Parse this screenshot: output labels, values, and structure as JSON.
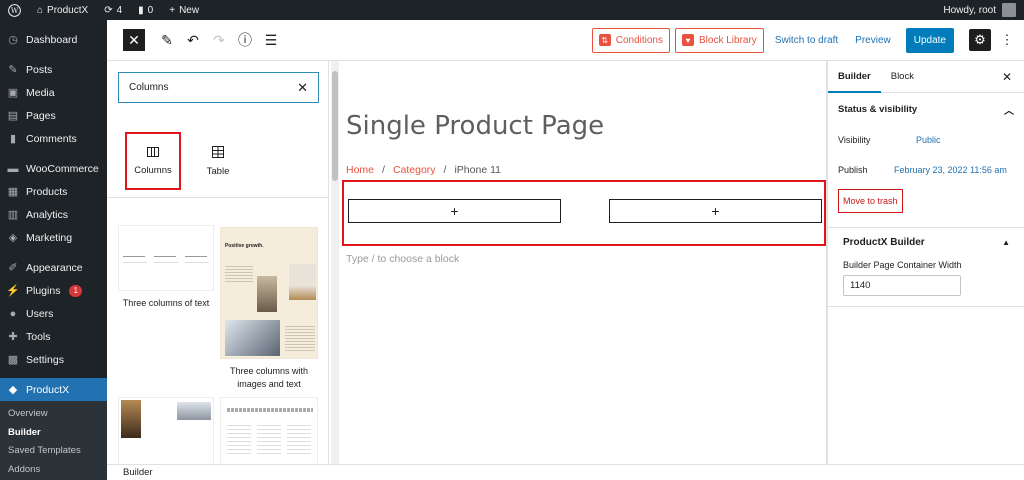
{
  "adminbar": {
    "site_name": "ProductX",
    "updates_count": "4",
    "comments_count": "0",
    "new_label": "New",
    "howdy": "Howdy, root"
  },
  "adminmenu": {
    "items": [
      {
        "label": "Dashboard",
        "icon": "dashboard-icon"
      },
      {
        "label": "Posts",
        "icon": "pin-icon"
      },
      {
        "label": "Media",
        "icon": "media-icon"
      },
      {
        "label": "Pages",
        "icon": "pages-icon"
      },
      {
        "label": "Comments",
        "icon": "comments-icon"
      },
      {
        "label": "WooCommerce",
        "icon": "woo-icon"
      },
      {
        "label": "Products",
        "icon": "archive-icon"
      },
      {
        "label": "Analytics",
        "icon": "bar-chart-icon"
      },
      {
        "label": "Marketing",
        "icon": "megaphone-icon"
      },
      {
        "label": "Appearance",
        "icon": "brush-icon"
      },
      {
        "label": "Plugins",
        "icon": "plug-icon",
        "badge": "1"
      },
      {
        "label": "Users",
        "icon": "user-icon"
      },
      {
        "label": "Tools",
        "icon": "wrench-icon"
      },
      {
        "label": "Settings",
        "icon": "settings-icon"
      },
      {
        "label": "ProductX",
        "icon": "productx-icon"
      }
    ],
    "submenu": [
      "Overview",
      "Builder",
      "Saved Templates",
      "Addons"
    ]
  },
  "header": {
    "conditions_label": "Conditions",
    "block_library_label": "Block Library",
    "switch_draft_label": "Switch to draft",
    "preview_label": "Preview",
    "update_label": "Update"
  },
  "inserter": {
    "search_value": "Columns",
    "blocks": [
      {
        "label": "Columns"
      },
      {
        "label": "Table"
      }
    ],
    "patterns": [
      {
        "label": "Three columns of text"
      },
      {
        "label": "Three columns with images and text"
      }
    ],
    "pattern_heading": "Positive growth."
  },
  "canvas": {
    "title": "Single Product Page",
    "breadcrumb": {
      "home": "Home",
      "sep": "/",
      "category": "Category",
      "current": "iPhone 11"
    },
    "appender": "+",
    "type_hint": "Type / to choose a block"
  },
  "sidebar": {
    "tab_builder": "Builder",
    "tab_block": "Block",
    "status_title": "Status & visibility",
    "visibility_label": "Visibility",
    "visibility_value": "Public",
    "publish_label": "Publish",
    "publish_value": "February 23, 2022 11:56 am",
    "trash_label": "Move to trash",
    "px_title": "ProductX Builder",
    "container_label": "Builder Page Container Width",
    "container_value": "1140"
  },
  "footer": {
    "label": "Builder"
  },
  "colors": {
    "accent": "#007cba",
    "brand": "#e8523f",
    "highlight": "#e0141b",
    "admin_dark": "#1d2327"
  }
}
